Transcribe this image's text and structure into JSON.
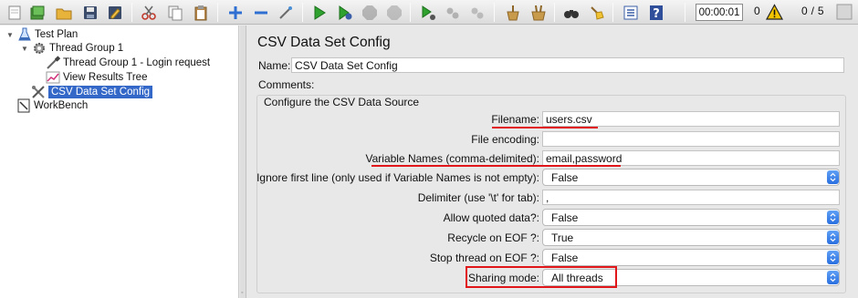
{
  "toolbar": {
    "timer": "00:00:01",
    "error_count": "0",
    "thread_counter": "0 / 5"
  },
  "tree": {
    "nodes": [
      {
        "label": "Test Plan",
        "icon": "test-plan-icon"
      },
      {
        "label": "Thread Group 1",
        "icon": "thread-group-gear-icon"
      },
      {
        "label": "Thread Group 1 - Login request",
        "icon": "http-sampler-pipette-icon"
      },
      {
        "label": "View Results Tree",
        "icon": "results-tree-graph-icon"
      },
      {
        "label": "CSV Data Set Config",
        "icon": "config-wrench-icon"
      },
      {
        "label": "WorkBench",
        "icon": "workbench-icon"
      }
    ]
  },
  "panel": {
    "title": "CSV Data Set Config",
    "name_label": "Name:",
    "name_value": "CSV Data Set Config",
    "comments_label": "Comments:",
    "comments_value": "",
    "legend": "Configure the CSV Data Source",
    "fields": {
      "filename": {
        "label": "Filename:",
        "value": "users.csv"
      },
      "encoding": {
        "label": "File encoding:",
        "value": ""
      },
      "varnames": {
        "label": "Variable Names (comma-delimited):",
        "value": "email,password"
      },
      "ignore_first": {
        "label": "Ignore first line (only used if Variable Names is not empty):",
        "value": "False"
      },
      "delimiter": {
        "label": "Delimiter (use '\\t' for tab):",
        "value": ","
      },
      "quoted": {
        "label": "Allow quoted data?:",
        "value": "False"
      },
      "recycle": {
        "label": "Recycle on EOF ?:",
        "value": "True"
      },
      "stop_thread": {
        "label": "Stop thread on EOF ?:",
        "value": "False"
      },
      "sharing": {
        "label": "Sharing mode:",
        "value": "All threads"
      }
    }
  },
  "colors": {
    "annotation_red": "#e0161b",
    "selection_blue": "#3468c8",
    "combo_arrow_blue": "#2a6fe0"
  }
}
